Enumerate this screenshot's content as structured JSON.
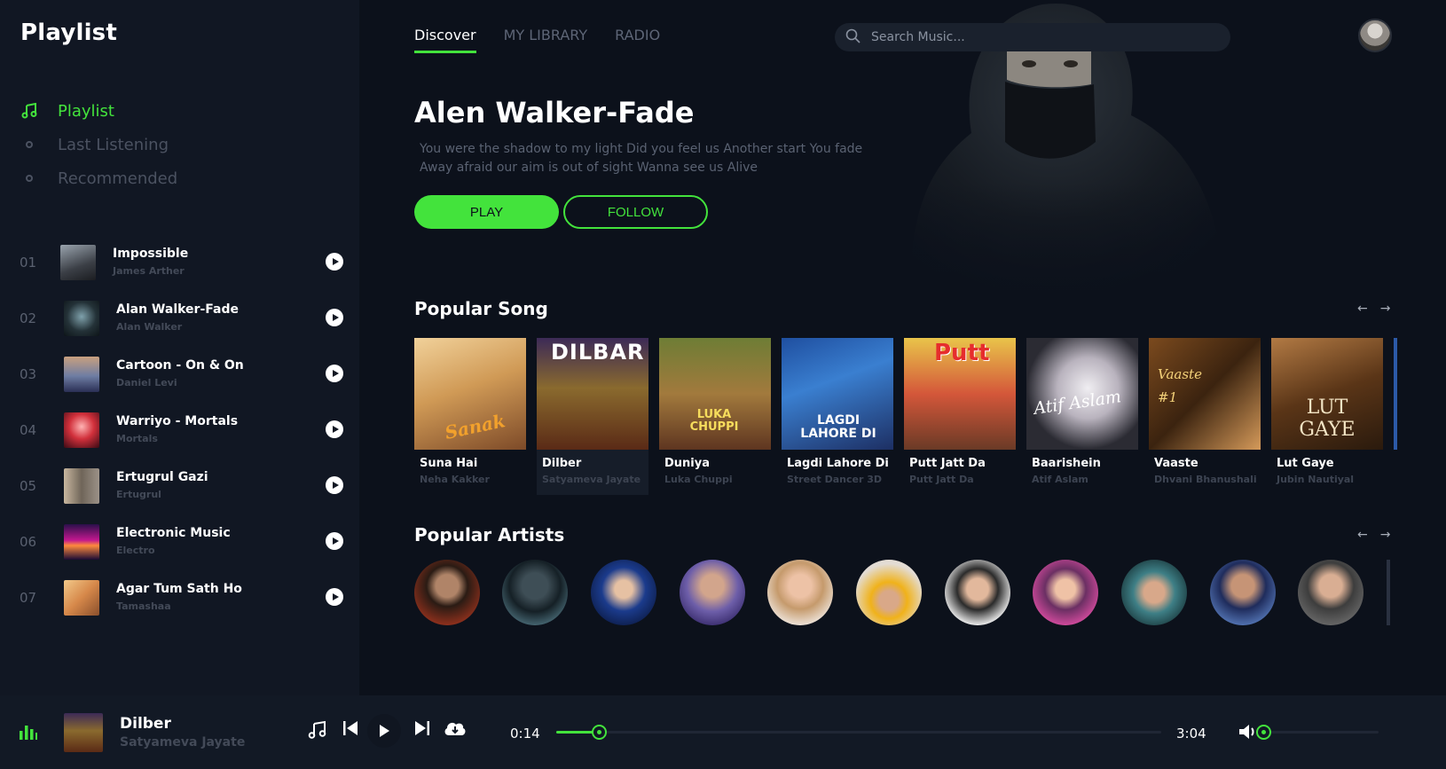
{
  "app": {
    "title": "Playlist"
  },
  "colors": {
    "accent": "#43e33c",
    "background": "#0c111b",
    "sidebar": "#111723"
  },
  "sidebar": {
    "nav": [
      {
        "label": "Playlist",
        "icon": "music-note-icon",
        "active": true
      },
      {
        "label": "Last Listening",
        "icon": "circle-icon"
      },
      {
        "label": "Recommended",
        "icon": "circle-icon"
      }
    ],
    "tracks": [
      {
        "num": "01",
        "title": "Impossible",
        "artist": "James Arther"
      },
      {
        "num": "02",
        "title": "Alan Walker-Fade",
        "artist": "Alan Walker"
      },
      {
        "num": "03",
        "title": "Cartoon - On & On",
        "artist": "Daniel Levi"
      },
      {
        "num": "04",
        "title": "Warriyo - Mortals",
        "artist": "Mortals"
      },
      {
        "num": "05",
        "title": "Ertugrul Gazi",
        "artist": "Ertugrul"
      },
      {
        "num": "06",
        "title": "Electronic Music",
        "artist": "Electro"
      },
      {
        "num": "07",
        "title": "Agar Tum Sath Ho",
        "artist": "Tamashaa"
      }
    ]
  },
  "header": {
    "tabs": [
      {
        "label": "Discover",
        "active": true
      },
      {
        "label": "MY LIBRARY"
      },
      {
        "label": "RADIO"
      }
    ],
    "search_placeholder": "Search Music..."
  },
  "hero": {
    "title": "Alen Walker-Fade",
    "description": "You were the shadow to my light Did you feel us Another start You fade Away afraid our aim is out of sight Wanna see us Alive",
    "play_label": "PLAY",
    "follow_label": "FOLLOW"
  },
  "popular_songs": {
    "title": "Popular Song",
    "prev_icon": "arrow-left-icon",
    "next_icon": "arrow-right-icon",
    "items": [
      {
        "title": "Suna Hai",
        "artist": "Neha Kakker",
        "cover_text": "Sanak"
      },
      {
        "title": "Dilber",
        "artist": "Satyameva Jayate",
        "cover_text": "DILBAR",
        "selected": true
      },
      {
        "title": "Duniya",
        "artist": "Luka Chuppi",
        "cover_text": "LUKA CHUPPI"
      },
      {
        "title": "Lagdi Lahore Di",
        "artist": "Street Dancer 3D",
        "cover_text": "LAGDI LAHORE DI"
      },
      {
        "title": "Putt Jatt Da",
        "artist": "Putt Jatt Da",
        "cover_text": "Putt"
      },
      {
        "title": "Baarishein",
        "artist": "Atif Aslam",
        "cover_text": "Atif Aslam"
      },
      {
        "title": "Vaaste",
        "artist": "Dhvani Bhanushali",
        "cover_text": "Vaaste #1"
      },
      {
        "title": "Lut Gaye",
        "artist": "Jubin Nautiyal",
        "cover_text": "LUT GAYE"
      }
    ]
  },
  "popular_artists": {
    "title": "Popular Artists",
    "prev_icon": "arrow-left-icon",
    "next_icon": "arrow-right-icon"
  },
  "player": {
    "title": "Dilber",
    "artist": "Satyameva Jayate",
    "current_time": "0:14",
    "duration": "3:04",
    "progress": 0.07,
    "volume": 0.0
  }
}
